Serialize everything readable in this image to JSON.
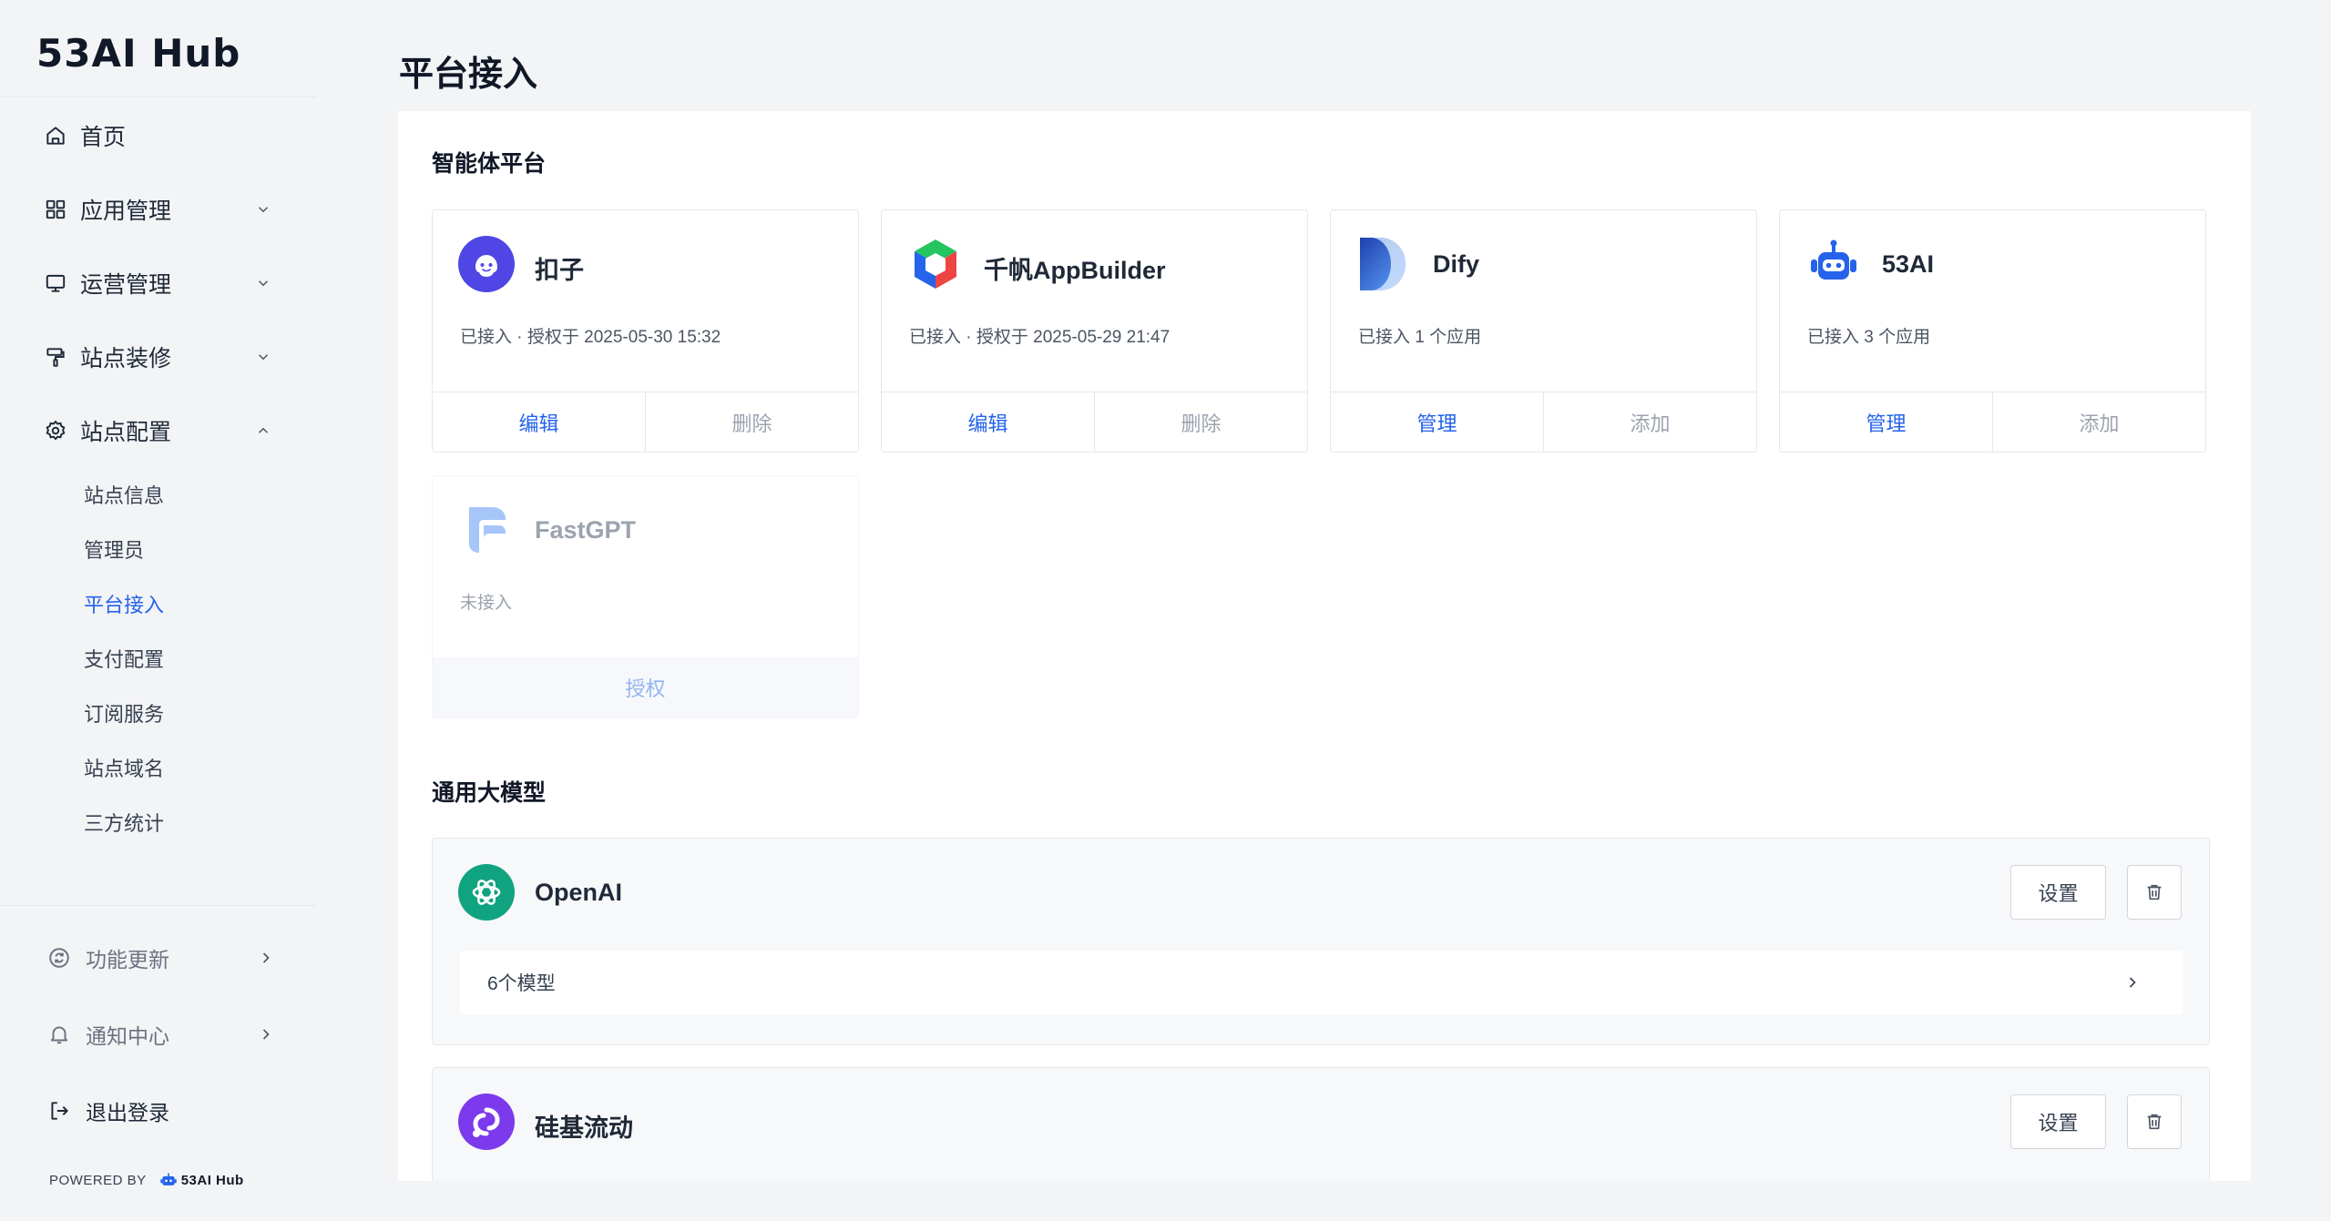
{
  "app": {
    "brand": "53AI Hub"
  },
  "sidebar": {
    "items": [
      {
        "label": "首页",
        "icon": "home-icon"
      },
      {
        "label": "应用管理",
        "icon": "grid-icon"
      },
      {
        "label": "运营管理",
        "icon": "monitor-icon"
      },
      {
        "label": "站点装修",
        "icon": "paint-roller-icon"
      },
      {
        "label": "站点配置",
        "icon": "gear-icon"
      }
    ],
    "sub_items": [
      {
        "label": "站点信息"
      },
      {
        "label": "管理员"
      },
      {
        "label": "平台接入",
        "active": true
      },
      {
        "label": "支付配置"
      },
      {
        "label": "订阅服务"
      },
      {
        "label": "站点域名"
      },
      {
        "label": "三方统计"
      }
    ],
    "bottom": {
      "updates": "功能更新",
      "notifications": "通知中心",
      "logout": "退出登录",
      "powered_by": "POWERED BY",
      "powered_brand": "53AI Hub"
    }
  },
  "main": {
    "title": "平台接入",
    "agent_section": {
      "title": "智能体平台",
      "cards": [
        {
          "name": "扣子",
          "status": "已接入 · 授权于 2025-05-30 15:32",
          "actions": [
            "编辑",
            "删除"
          ]
        },
        {
          "name": "千帆AppBuilder",
          "status": "已接入 · 授权于 2025-05-29 21:47",
          "actions": [
            "编辑",
            "删除"
          ]
        },
        {
          "name": "Dify",
          "status": "已接入 1 个应用",
          "actions": [
            "管理",
            "添加"
          ]
        },
        {
          "name": "53AI",
          "status": "已接入 3 个应用",
          "actions": [
            "管理",
            "添加"
          ]
        },
        {
          "name": "FastGPT",
          "status": "未接入",
          "actions": [
            "授权"
          ]
        }
      ]
    },
    "model_section": {
      "title": "通用大模型",
      "providers": [
        {
          "name": "OpenAI",
          "settings": "设置",
          "models": "6个模型"
        },
        {
          "name": "硅基流动",
          "settings": "设置"
        }
      ]
    }
  },
  "colors": {
    "accent": "#2563eb",
    "openai": "#10a37f",
    "siliconflow": "#7c3aed",
    "coze": "#4f46e5"
  }
}
